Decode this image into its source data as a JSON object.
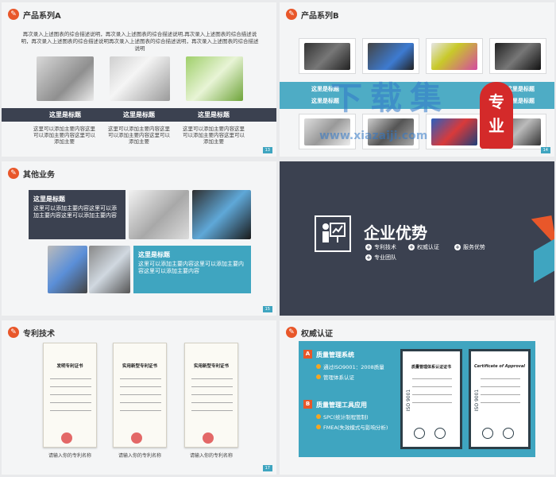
{
  "slide1": {
    "title": "产品系列A",
    "desc": "再次录入上述图表的综合描述说明，再次录入上述图表的综合描述说明,再次录入上述图表的综合描述说明，再次录入上述图表的综合描述说明再次录入上述图表的综合描述说明，再次录入上述图表的综合描述说明",
    "items": [
      {
        "heading": "这里是标题",
        "caption": "这里可以添加主要内容这里可以添加主要内容这里可以添加主要"
      },
      {
        "heading": "这里是标题",
        "caption": "这里可以添加主要内容这里可以添加主要内容这里可以添加主要"
      },
      {
        "heading": "这里是标题",
        "caption": "这里可以添加主要内容这里可以添加主要内容这里可以添加主要"
      }
    ],
    "page": "13"
  },
  "slide2": {
    "title": "产品系列B",
    "labels": [
      "这里是标题",
      "这里是标题",
      "这里是标题",
      "这里是标题"
    ],
    "page": "14"
  },
  "watermark": {
    "line1": "下载集",
    "line2": "www.xiazaiji.com",
    "badge": "专业"
  },
  "slide3": {
    "title": "其他业务",
    "box1_title": "这里是标题",
    "box1_body": "这里可以添加主要内容这里可以添加主要内容这里可以添加主要内容",
    "box2_title": "这里是标题",
    "box2_body": "这里可以添加主要内容这里可以添加主要内容这里可以添加主要内容",
    "page": "15"
  },
  "slide4": {
    "title": "企业优势",
    "items": [
      "专利技术",
      "权威认证",
      "服务优势",
      "专业团队"
    ]
  },
  "slide5": {
    "title": "专利技术",
    "certs": [
      {
        "name": "发明专利证书",
        "caption": "请输入你的专利名称"
      },
      {
        "name": "实用新型专利证书",
        "caption": "请输入你的专利名称"
      },
      {
        "name": "实用新型专利证书",
        "caption": "请输入你的专利名称"
      }
    ],
    "page": "17"
  },
  "slide6": {
    "title": "权威认证",
    "secA_badge": "A",
    "secA_title": "质量管理系统",
    "secA_items": [
      "通过ISO9001：2008质量",
      "管理体系认证"
    ],
    "secB_badge": "B",
    "secB_title": "质量管理工具应用",
    "secB_items": [
      "SPC(统计制程管制)",
      "FMEA(失效模式与影响分析)"
    ],
    "cert1": "质量管理体系认证证书",
    "cert2": "Certificate of Approval",
    "iso": "ISO 9001"
  },
  "colors": {
    "accent": "#e8572a",
    "teal": "#3fa5c0",
    "dark": "#3b4150"
  }
}
